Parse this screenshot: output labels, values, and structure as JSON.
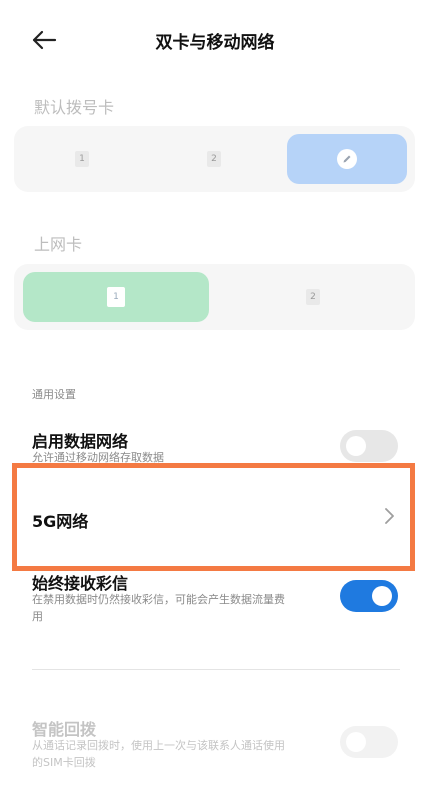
{
  "header": {
    "title": "双卡与移动网络",
    "back_icon": "arrow-left-icon"
  },
  "default_dial": {
    "label": "默认拨号卡",
    "options": [
      {
        "label": "1",
        "selected": false
      },
      {
        "label": "2",
        "selected": false
      },
      {
        "label": "",
        "icon": "pencil-icon",
        "selected": true
      }
    ],
    "selected_color": "#b6d3f8"
  },
  "data_card": {
    "label": "上网卡",
    "options": [
      {
        "label": "1",
        "selected": true
      },
      {
        "label": "2",
        "selected": false
      }
    ],
    "selected_color": "#b4e7c8"
  },
  "general": {
    "label": "通用设置",
    "items": [
      {
        "title": "启用数据网络",
        "subtitle": "允许通过移动网络存取数据",
        "toggle": "off"
      },
      {
        "title": "5G网络",
        "chevron": "chevron-right-icon",
        "highlight_color": "#f47a43"
      },
      {
        "title": "始终接收彩信",
        "subtitle_line1": "在禁用数据时仍然接收彩信，可能会产生数据流量费",
        "subtitle_line2": "用",
        "toggle": "on",
        "toggle_color": "#1f7ae0"
      },
      {
        "title": "智能回拨",
        "subtitle_line1": "从通话记录回拨时，使用上一次与该联系人通话使用",
        "subtitle_line2": "的SIM卡回拨",
        "toggle": "disabled"
      }
    ]
  }
}
